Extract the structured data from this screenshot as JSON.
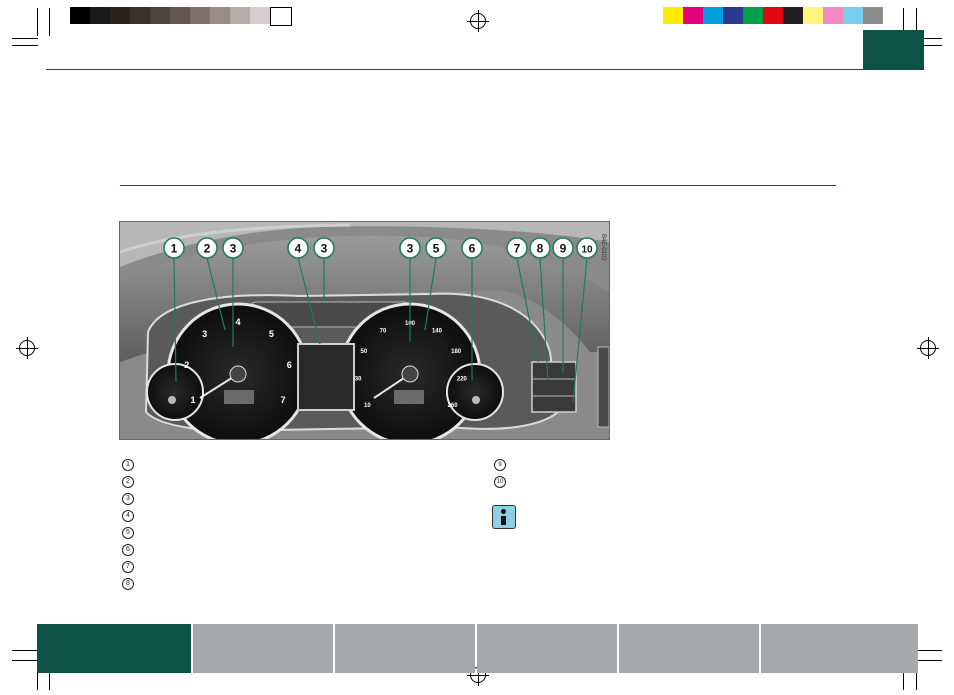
{
  "image_code": "B4E-0102",
  "callouts": [
    "1",
    "2",
    "3",
    "4",
    "3",
    "3",
    "5",
    "6",
    "7",
    "8",
    "9",
    "10"
  ],
  "legend_left": [
    "1",
    "2",
    "3",
    "4",
    "5",
    "6",
    "7",
    "8"
  ],
  "legend_right": [
    "9",
    "10"
  ],
  "colors": {
    "brand_green": "#0e5247",
    "tab_gray": "#a7a9ac",
    "callout_green": "#1f7a5c"
  },
  "gauges": {
    "tachometer_ticks": [
      "1",
      "2",
      "3",
      "4",
      "5",
      "6",
      "7"
    ],
    "speedometer_ticks": [
      "10",
      "30",
      "50",
      "70",
      "100",
      "140",
      "180",
      "220",
      "260"
    ]
  },
  "icons": {
    "info": "info-icon",
    "registration": "registration-mark-icon"
  },
  "color_bar": [
    "#000000",
    "#1a1a1a",
    "#2b2220",
    "#3a302d",
    "#4c4240",
    "#625755",
    "#7d7270",
    "#988d8b",
    "#b5acaa",
    "#d4cfce",
    "#ffffff",
    "#ffeb00",
    "#e4007d",
    "#00a0e0",
    "#2b3a8f",
    "#00a14b",
    "#e30613",
    "#231f20",
    "#fff57a",
    "#f08ac0",
    "#79cdf0",
    "#8c8c8c"
  ]
}
